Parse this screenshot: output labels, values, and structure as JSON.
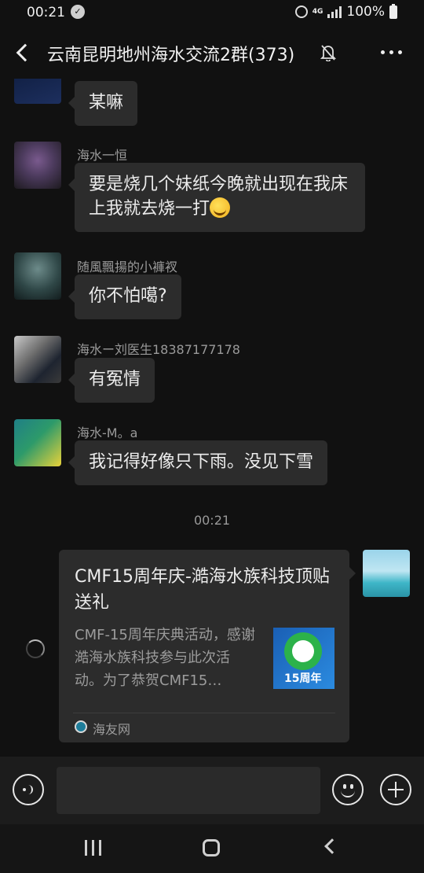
{
  "status_bar": {
    "time": "00:21",
    "battery": "100%",
    "network": "4G"
  },
  "header": {
    "title": "云南昆明地州海水交流2群(373)"
  },
  "messages": [
    {
      "sender": "",
      "text": "某嘛"
    },
    {
      "sender": "海水一恒",
      "text": "要是烧几个妹纸今晚就出现在我床上我就去烧一打"
    },
    {
      "sender": "随風飄揚的小褲衩",
      "text": "你不怕噶?"
    },
    {
      "sender": "海水ー刘医生18387177178",
      "text": "有冤情"
    },
    {
      "sender": "海水-M。a",
      "text": "我记得好像只下雨。没见下雪"
    }
  ],
  "timestamp": "00:21",
  "link_card": {
    "title": "CMF15周年庆-澔海水族科技顶贴送礼",
    "description": "CMF-15周年庆典活动，感谢澔海水族科技参与此次活动。为了恭贺CMF15…",
    "thumb_label": "15周年",
    "source": "海友网"
  },
  "input": {
    "placeholder": ""
  },
  "colors": {
    "background": "#111111",
    "bubble": "#2c2c2c",
    "accent_text": "#9a9a9a"
  }
}
